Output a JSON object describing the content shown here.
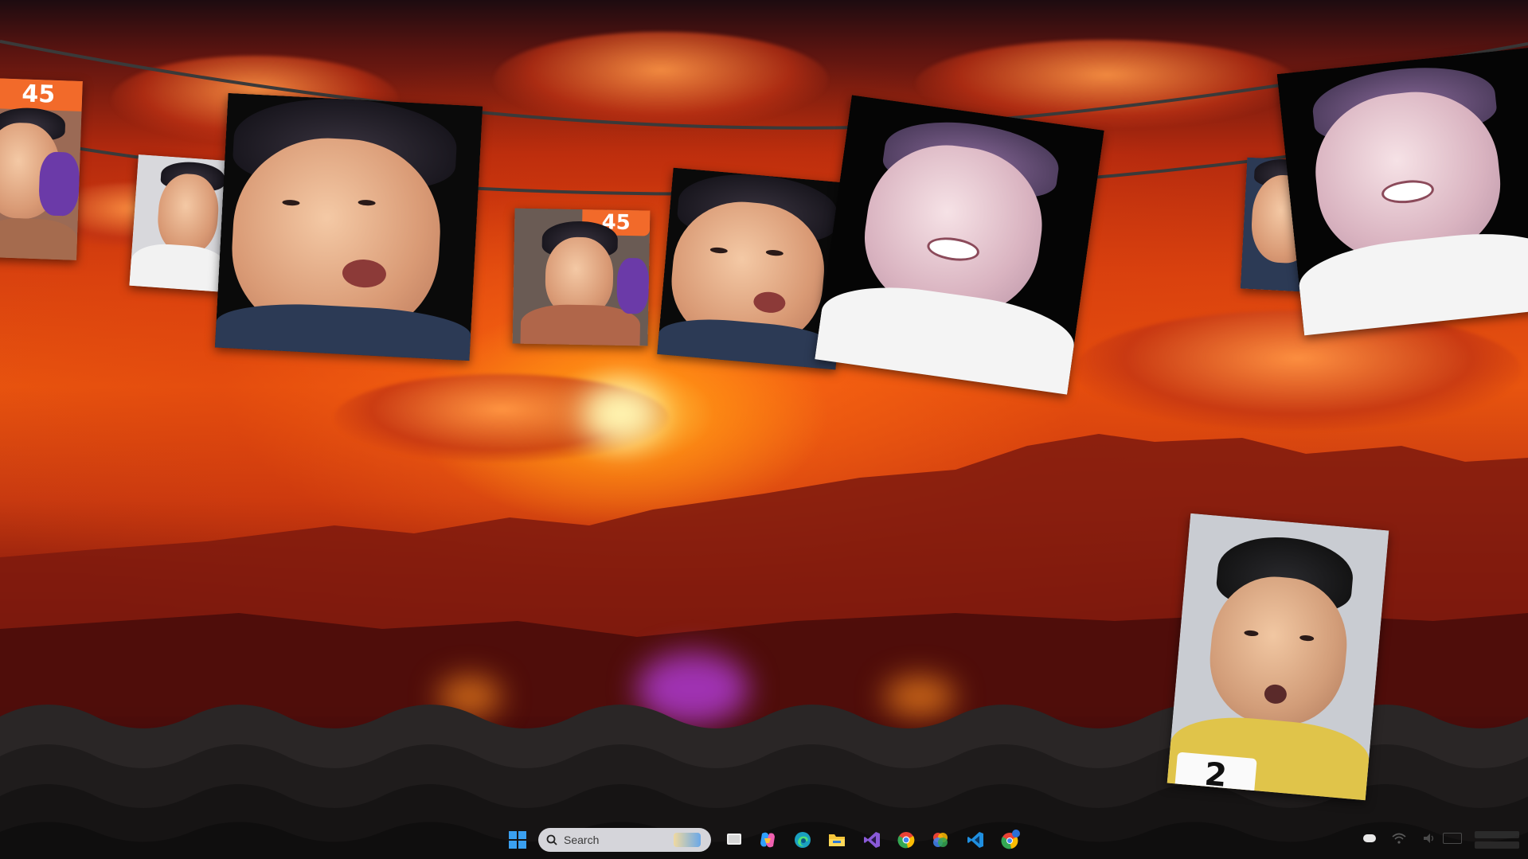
{
  "desktop": {
    "wallpaper": "sunset-over-mountains",
    "colors": {
      "sky_top": "#1d0b10",
      "sky_mid": "#e8540f",
      "sun": "#ffd850",
      "wave": "#1a1a1a"
    }
  },
  "photos": {
    "badge_left": "45",
    "badge_center": "45",
    "badge_bottom": "2"
  },
  "taskbar": {
    "search": {
      "placeholder": "Search"
    },
    "icons": [
      "windows-start-icon",
      "search-icon",
      "task-view-icon",
      "copilot-icon",
      "edge-icon",
      "file-explorer-icon",
      "visual-studio-icon",
      "chrome-icon",
      "color-app-icon",
      "vscode-icon",
      "chrome-profile-icon"
    ],
    "tray_icons": [
      "onedrive-icon",
      "wifi-icon",
      "volume-icon",
      "battery-icon"
    ]
  }
}
